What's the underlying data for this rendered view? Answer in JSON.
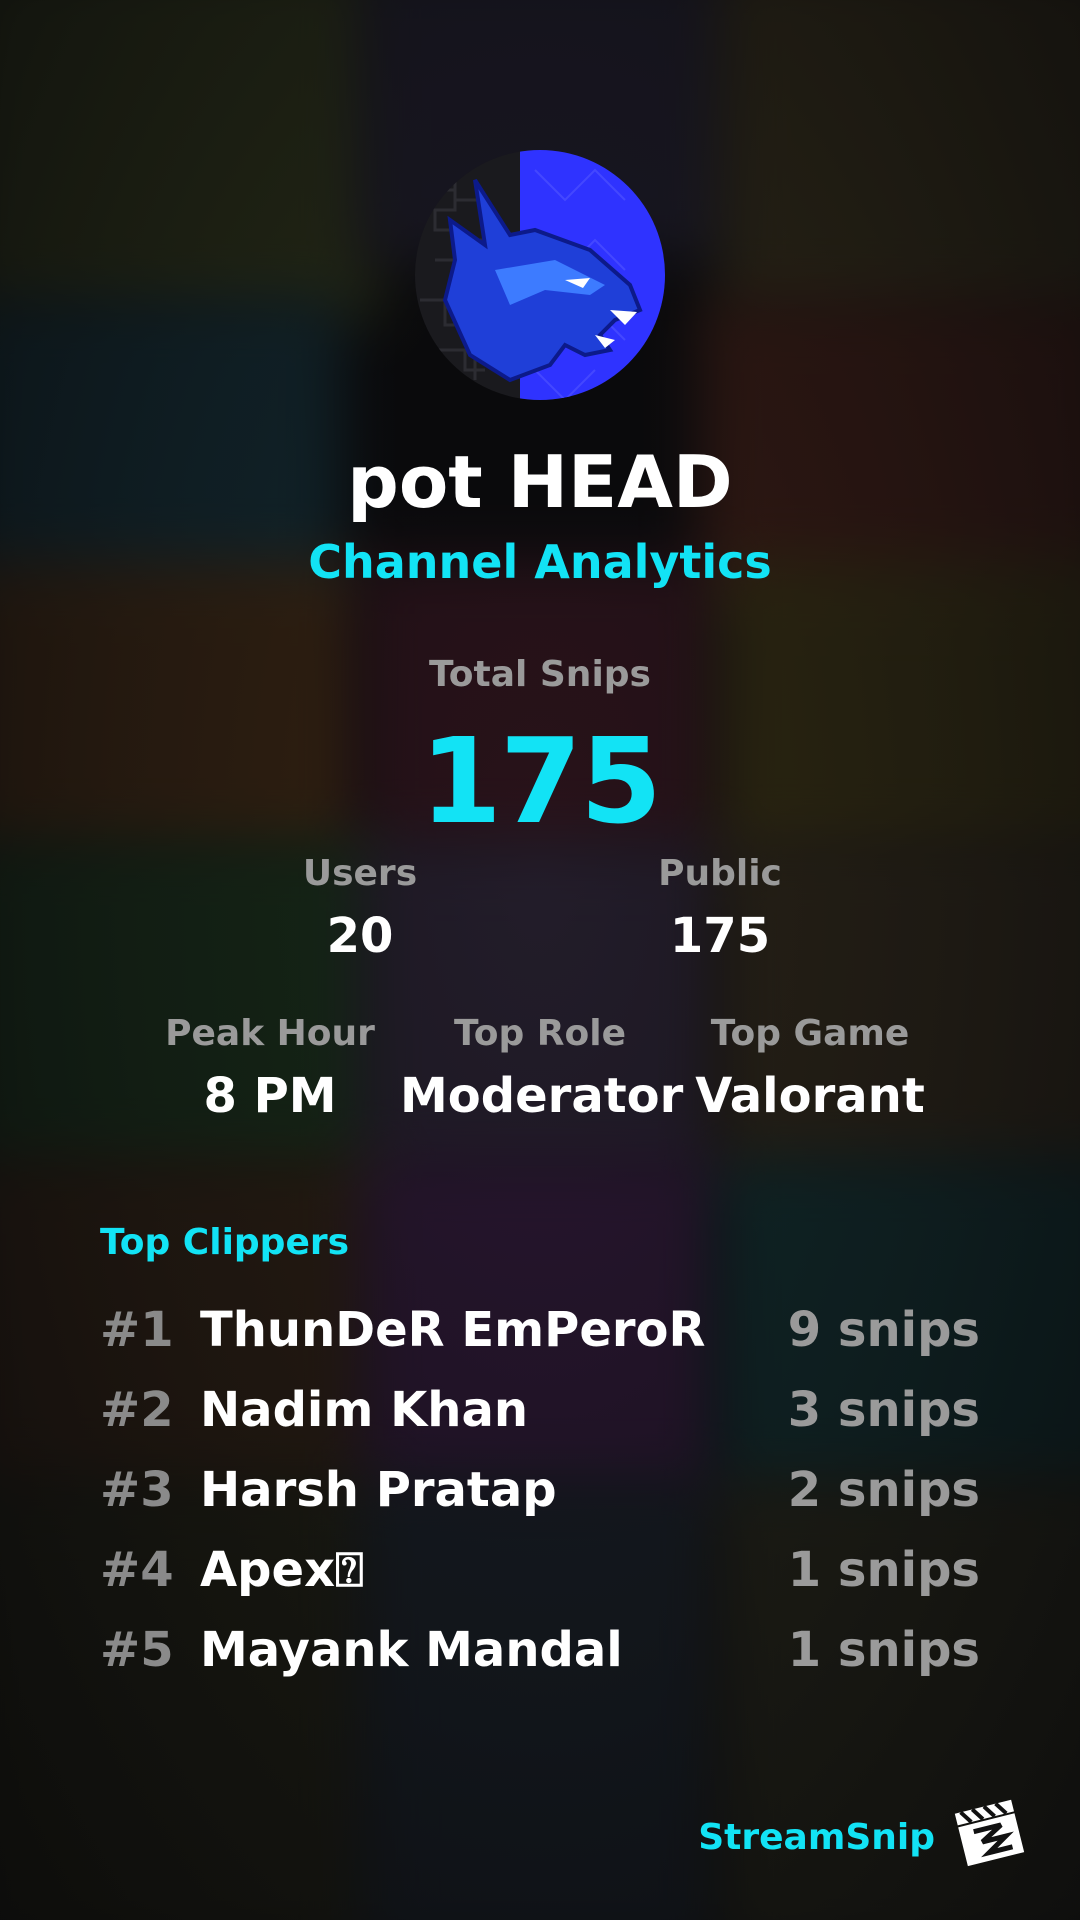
{
  "channel": {
    "name": "pot HEAD",
    "subtitle": "Channel Analytics"
  },
  "stats": {
    "total_snips_label": "Total Snips",
    "total_snips_value": "175",
    "users_label": "Users",
    "users_value": "20",
    "public_label": "Public",
    "public_value": "175",
    "peak_hour_label": "Peak Hour",
    "peak_hour_value": "8 PM",
    "top_role_label": "Top Role",
    "top_role_value": "Moderator",
    "top_game_label": "Top Game",
    "top_game_value": "Valorant"
  },
  "top_clippers": {
    "heading": "Top Clippers",
    "rows": [
      {
        "rank": "#1",
        "name": "ThunDeR EmPeroR",
        "count": "9 snips"
      },
      {
        "rank": "#2",
        "name": "Nadim Khan",
        "count": "3 snips"
      },
      {
        "rank": "#3",
        "name": "Harsh Pratap",
        "count": "2 snips"
      },
      {
        "rank": "#4",
        "name": "Apex⍰",
        "count": "1 snips"
      },
      {
        "rank": "#5",
        "name": "Mayank Mandal",
        "count": "1 snips"
      }
    ]
  },
  "branding": {
    "name": "StreamSnip",
    "logo_icon": "clapperboard-icon"
  },
  "colors": {
    "accent": "#12e3f5",
    "muted": "#9a9a9a",
    "text": "#ffffff",
    "avatar_blue": "#2f33ff"
  },
  "icons": {
    "avatar": "blue-dragon-mascot-avatar"
  }
}
